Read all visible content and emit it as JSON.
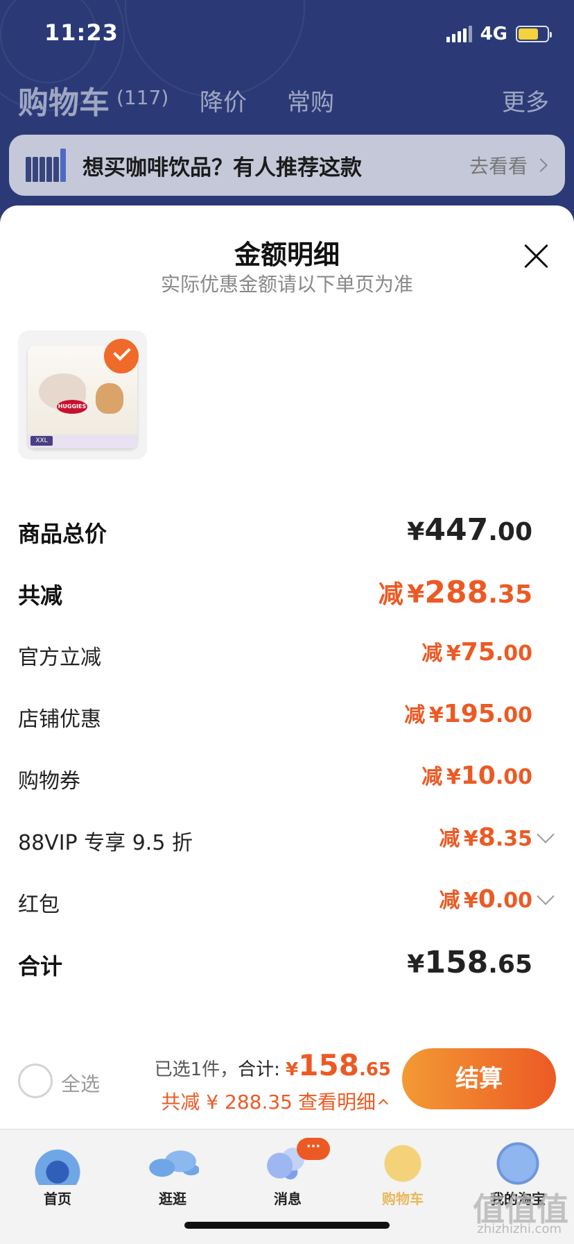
{
  "status_bar": {
    "time": "11:23",
    "network": "4G",
    "battery_level": 0.7
  },
  "cart_nav": {
    "title": "购物车",
    "count": "(117)",
    "tabs": [
      "降价",
      "常购"
    ],
    "more": "更多"
  },
  "promo_banner": {
    "text": "想买咖啡饮品？有人推荐这款",
    "link": "去看看"
  },
  "sheet": {
    "title": "金额明细",
    "subtitle": "实际优惠金额请以下单页为准"
  },
  "product": {
    "brand_text": "HUGGIES",
    "size_text": "XXL",
    "selected": true
  },
  "details": [
    {
      "label": "商品总价",
      "prefix": "",
      "currency": "¥",
      "int": "447",
      "dec": ".00"
    },
    {
      "label": "共减",
      "prefix": "减",
      "currency": "¥",
      "int": "288",
      "dec": ".35"
    },
    {
      "label": "官方立减",
      "prefix": "减",
      "currency": "¥",
      "int": "75",
      "dec": ".00"
    },
    {
      "label": "店铺优惠",
      "prefix": "减",
      "currency": "¥",
      "int": "195",
      "dec": ".00"
    },
    {
      "label": "购物券",
      "prefix": "减",
      "currency": "¥",
      "int": "10",
      "dec": ".00"
    },
    {
      "label": "88VIP 专享 9.5 折",
      "prefix": "减",
      "currency": "¥",
      "int": "8",
      "dec": ".35"
    },
    {
      "label": "红包",
      "prefix": "减",
      "currency": "¥",
      "int": "0",
      "dec": ".00"
    },
    {
      "label": "合计",
      "prefix": "",
      "currency": "¥",
      "int": "158",
      "dec": ".65"
    }
  ],
  "checkout": {
    "select_all": "全选",
    "selected_text": "已选1件，",
    "total_label": "合计: ",
    "currency": "¥",
    "total_int": "158",
    "total_dec": ".65",
    "saved_text": "共减 ¥ 288.35",
    "view_detail": "查看明细",
    "button": "结算"
  },
  "tab_bar": {
    "items": [
      {
        "label": "首页",
        "icon": "home-icon"
      },
      {
        "label": "逛逛",
        "icon": "stroll-icon"
      },
      {
        "label": "消息",
        "icon": "message-icon"
      },
      {
        "label": "购物车",
        "icon": "cart-icon"
      },
      {
        "label": "我的淘宝",
        "icon": "my-taobao-icon"
      }
    ],
    "message_badge": "···",
    "active_index": 3
  },
  "watermark": {
    "logo": "值",
    "site": "zhizhizhi.com"
  },
  "colors": {
    "header_bg": "#2b3a77",
    "accent": "#ec5a24",
    "active_tab": "#e8b85a"
  }
}
